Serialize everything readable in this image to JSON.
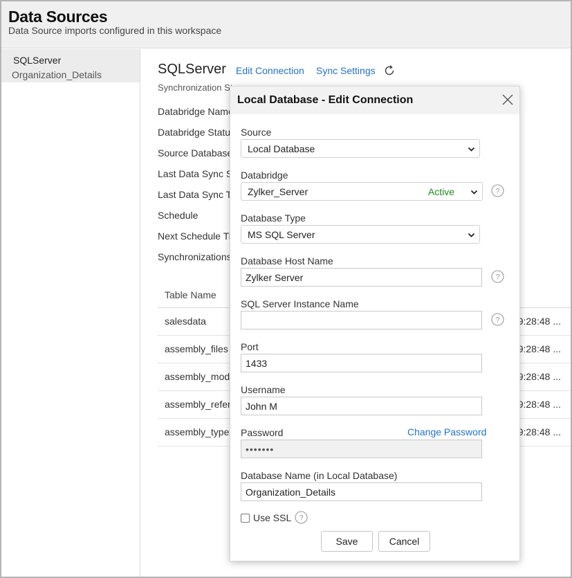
{
  "app": {
    "title": "Data Sources",
    "subtitle": "Data Source imports configured in this workspace"
  },
  "sidebar": {
    "items": [
      {
        "title": "SQLServer",
        "subtitle": "Organization_Details"
      }
    ]
  },
  "main": {
    "title": "SQLServer",
    "edit_connection_label": "Edit Connection",
    "sync_settings_label": "Sync Settings",
    "sync_subtitle": "Synchronization St",
    "details": [
      "Databridge Name",
      "Databridge Status",
      "Source Database",
      "Last Data Sync St",
      "Last Data Sync Ti",
      "Schedule",
      "Next Schedule Ti",
      "Synchronizations"
    ],
    "table": {
      "header": "Table Name",
      "rows": [
        {
          "name": "salesdata",
          "time": "9:28:48 ..."
        },
        {
          "name": "assembly_files",
          "time": "9:28:48 ..."
        },
        {
          "name": "assembly_modu",
          "time": "9:28:48 ..."
        },
        {
          "name": "assembly_refere",
          "time": "9:28:48 ..."
        },
        {
          "name": "assembly_types",
          "time": "9:28:48 ..."
        }
      ]
    }
  },
  "dialog": {
    "title": "Local Database - Edit Connection",
    "source": {
      "label": "Source",
      "value": "Local Database"
    },
    "databridge": {
      "label": "Databridge",
      "value": "Zylker_Server",
      "status": "Active"
    },
    "database_type": {
      "label": "Database Type",
      "value": "MS SQL Server"
    },
    "host": {
      "label": "Database Host Name",
      "value": "Zylker Server"
    },
    "instance": {
      "label": "SQL Server Instance Name",
      "value": ""
    },
    "port": {
      "label": "Port",
      "value": "1433"
    },
    "username": {
      "label": "Username",
      "value": "John M"
    },
    "password": {
      "label": "Password",
      "value": "•••••••",
      "change_label": "Change Password"
    },
    "db_name": {
      "label": "Database Name (in Local Database)",
      "value": "Organization_Details"
    },
    "use_ssl": {
      "label": "Use SSL",
      "checked": false
    },
    "save_label": "Save",
    "cancel_label": "Cancel"
  },
  "colors": {
    "link": "#2472c8",
    "active": "#1e8a1e",
    "header_bg": "#f0f0f0"
  },
  "icons": [
    "refresh-icon",
    "close-icon",
    "help-icon",
    "chevron-down-icon"
  ]
}
